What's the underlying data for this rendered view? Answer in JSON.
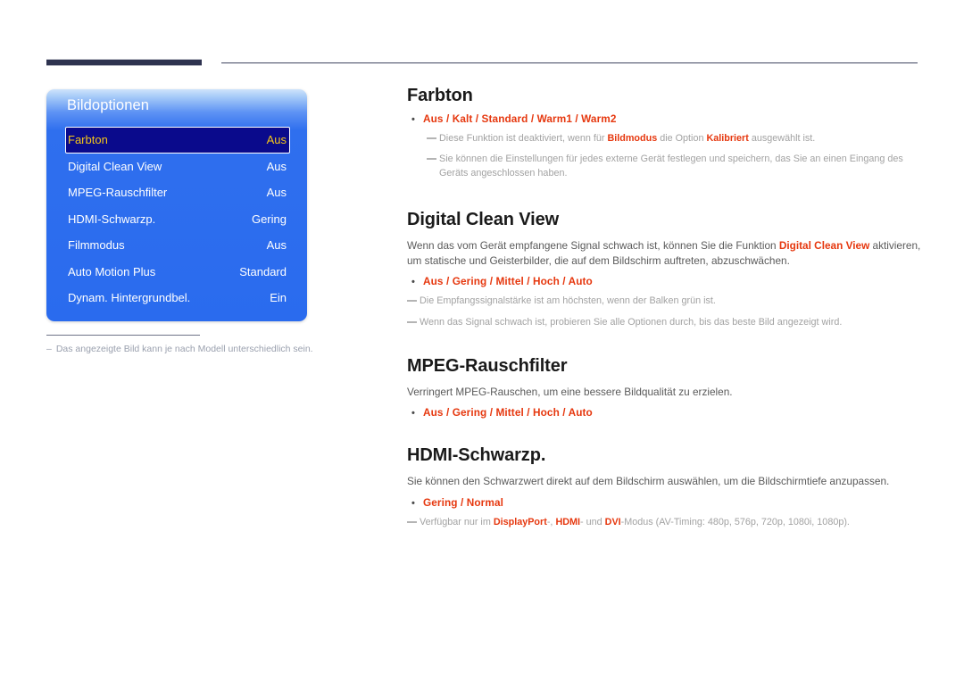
{
  "header": {
    "thick_bar": "",
    "thin_rule": ""
  },
  "osd": {
    "title": "Bildoptionen",
    "rows": [
      {
        "label": "Farbton",
        "value": "Aus",
        "selected": true
      },
      {
        "label": "Digital Clean View",
        "value": "Aus",
        "selected": false
      },
      {
        "label": "MPEG-Rauschfilter",
        "value": "Aus",
        "selected": false
      },
      {
        "label": "HDMI-Schwarzp.",
        "value": "Gering",
        "selected": false
      },
      {
        "label": "Filmmodus",
        "value": "Aus",
        "selected": false
      },
      {
        "label": "Auto Motion Plus",
        "value": "Standard",
        "selected": false
      },
      {
        "label": "Dynam. Hintergrundbel.",
        "value": "Ein",
        "selected": false
      }
    ],
    "footnote_dash": "–",
    "footnote": "Das angezeigte Bild kann je nach Modell unterschiedlich sein."
  },
  "content": {
    "farbton": {
      "title": "Farbton",
      "bullet_dot": "•",
      "options": "Aus / Kalt / Standard / Warm1 / Warm2",
      "note1_a": "Diese Funktion ist deaktiviert, wenn für ",
      "note1_hl1": "Bildmodus",
      "note1_b": " die Option ",
      "note1_hl2": "Kalibriert",
      "note1_c": " ausgewählt ist.",
      "note2": "Sie können die Einstellungen für jedes externe Gerät festlegen und speichern, das Sie an einen Eingang des Geräts angeschlossen haben."
    },
    "digital_clean_view": {
      "title": "Digital Clean View",
      "body_a": "Wenn das vom Gerät empfangene Signal schwach ist, können Sie die Funktion ",
      "body_hl": "Digital Clean View",
      "body_b": " aktivieren, um statische und Geisterbilder, die auf dem Bildschirm auftreten, abzuschwächen.",
      "bullet_dot": "•",
      "options": "Aus / Gering / Mittel / Hoch / Auto",
      "note1": "Die Empfangssignalstärke ist am höchsten, wenn der Balken grün ist.",
      "note2": "Wenn das Signal schwach ist, probieren Sie alle Optionen durch, bis das beste Bild angezeigt wird."
    },
    "mpeg": {
      "title": "MPEG-Rauschfilter",
      "body": "Verringert MPEG-Rauschen, um eine bessere Bildqualität zu erzielen.",
      "bullet_dot": "•",
      "options": "Aus / Gering / Mittel / Hoch / Auto"
    },
    "hdmi": {
      "title": "HDMI-Schwarzp.",
      "body": "Sie können den Schwarzwert direkt auf dem Bildschirm auswählen, um die Bildschirmtiefe anzupassen.",
      "bullet_dot": "•",
      "options": "Gering / Normal",
      "note_a": "Verfügbar nur im ",
      "note_hl1": "DisplayPort",
      "note_b": "-, ",
      "note_hl2": "HDMI",
      "note_c": "- und ",
      "note_hl3": "DVI",
      "note_d": "-Modus (AV-Timing: 480p, 576p, 720p, 1080i, 1080p)."
    }
  },
  "colors": {
    "accent_red": "#e6380f",
    "osd_blue": "#2f6fee",
    "osd_selected_navy": "#0a0a8c",
    "osd_selected_text": "#f5c518",
    "header_bar": "#2e3350",
    "body_text": "#5a5a5a",
    "note_text": "#a2a2a2"
  }
}
